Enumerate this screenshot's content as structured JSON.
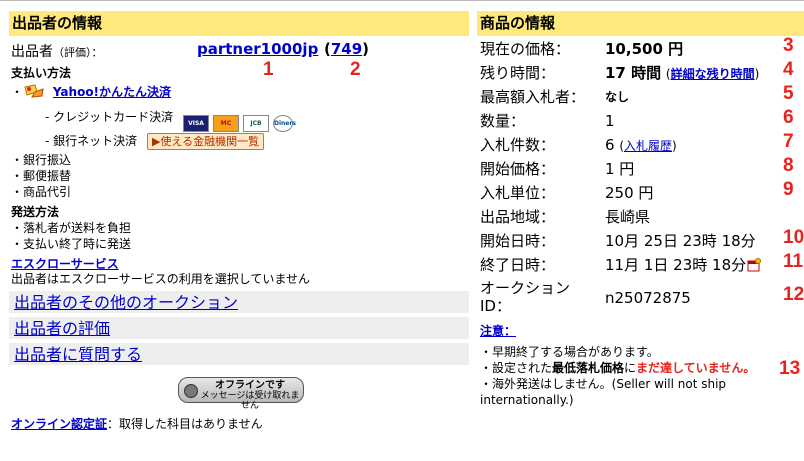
{
  "seller": {
    "header": "出品者の情報",
    "label_main": "出品者",
    "label_rating": "（評価）：",
    "id": "partner1000jp",
    "score": "749",
    "annot_id": "1",
    "annot_score": "2",
    "payment_title": "支払い方法",
    "yahoo_pay": "Yahoo!かんたん決済",
    "credit": "- クレジットカード決済",
    "card_names": [
      "VISA",
      "MC",
      "JCB",
      "Diners"
    ],
    "bank_net": "- 銀行ネット決済",
    "bank_button": "▶使える金融機関一覧",
    "methods": [
      "・銀行振込",
      "・郵便振替",
      "・商品代引"
    ],
    "shipping_title": "発送方法",
    "shipping": [
      "・落札者が送料を負担",
      "・支払い終了時に発送"
    ],
    "escrow_link": "エスクローサービス",
    "escrow_text": "出品者はエスクローサービスの利用を選択していません",
    "links": [
      "出品者のその他のオークション",
      "出品者の評価",
      "出品者に質問する"
    ],
    "offline_line1": "オフラインです",
    "offline_line2": "メッセージは受け取れません",
    "cert_link": "オンライン認定証",
    "cert_text": "：取得した科目はありません"
  },
  "item": {
    "header": "商品の情報",
    "rows": [
      {
        "label": "現在の価格：",
        "value": "10,500 円",
        "annot": "3"
      },
      {
        "label": "残り時間：",
        "value": "17 時間",
        "link": "詳細な残り時間",
        "annot": "4"
      },
      {
        "label": "最高額入札者：",
        "value": "なし",
        "annot": "5"
      },
      {
        "label": "数量：",
        "value": "1",
        "annot": "6"
      },
      {
        "label": "入札件数：",
        "value": "6",
        "link": "入札履歴",
        "annot": "7"
      },
      {
        "label": "開始価格：",
        "value": "1 円",
        "annot": "8"
      },
      {
        "label": "入札単位：",
        "value": "250 円",
        "annot": "9"
      },
      {
        "label": "出品地域：",
        "value": "長崎県",
        "annot": ""
      },
      {
        "label": "開始日時：",
        "value": "10月 25日 23時 18分",
        "annot": "10"
      },
      {
        "label": "終了日時：",
        "value": "11月 1日 23時 18分",
        "annot": "11"
      },
      {
        "label": "オークション",
        "label2": "ID：",
        "value": "n25072875",
        "annot": "12"
      }
    ],
    "notice_link": "注意：",
    "notices": [
      "・早期終了する場合があります。",
      "・設定された",
      "最低落札価格",
      "に",
      "まだ達していません。",
      "・海外発送はしません。(Seller will not ship",
      "internationally.)"
    ],
    "notice_annot": "13"
  },
  "colors": {
    "header_bg": "#ffe87c",
    "annot_red": "#e8231e",
    "link_blue": "#0000cc",
    "linkbox_bg": "#eeeeee"
  }
}
